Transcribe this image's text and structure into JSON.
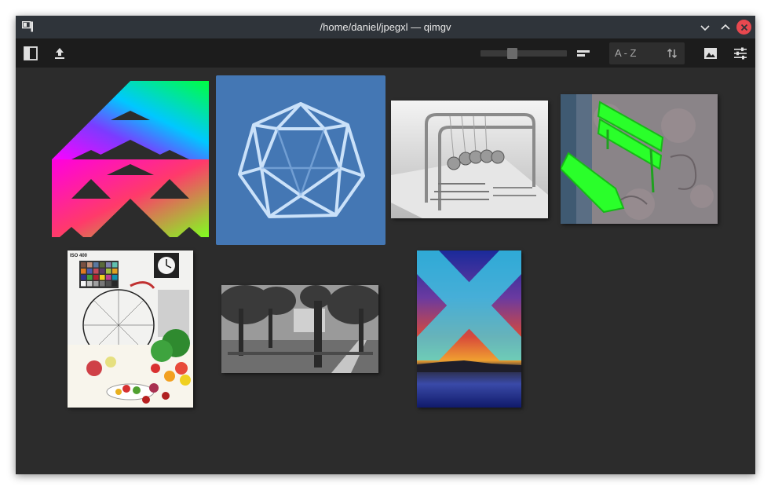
{
  "window": {
    "title": "/home/daniel/jpegxl — qimgv",
    "app_icon": "qimgv-logo-icon",
    "controls": [
      "minimize-icon",
      "maximize-icon",
      "close-icon"
    ],
    "colors": {
      "titlebar": "#2f343a",
      "toolbar": "#1c1c1c",
      "background": "#2c2c2c",
      "selection": "#4477b4",
      "close": "#e8484f"
    }
  },
  "toolbar": {
    "left_icons": [
      "toggle-panel-icon",
      "upload-icon"
    ],
    "zoom_slider": {
      "level": 0.35
    },
    "sort": {
      "label": "A - Z",
      "order_icon": "sort-order-icon"
    },
    "right_icons": [
      "view-mode-icon",
      "image-icon",
      "settings-icon"
    ]
  },
  "thumbnails": [
    {
      "name": "sierpinski-gradient",
      "selected": false
    },
    {
      "name": "wireframe-polyhedron",
      "selected": true
    },
    {
      "name": "newtons-cradle",
      "selected": false
    },
    {
      "name": "green-bench",
      "selected": false
    },
    {
      "name": "color-chart-still-life",
      "selected": false
    },
    {
      "name": "park-monochrome",
      "selected": false
    },
    {
      "name": "sunset-x-abstract",
      "selected": false
    }
  ],
  "test_chart_text": "ISO 400"
}
